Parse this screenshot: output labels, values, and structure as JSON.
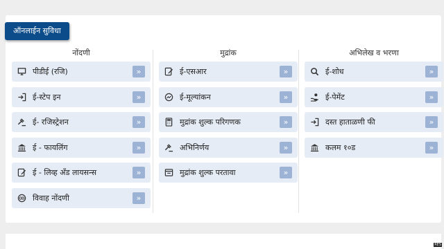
{
  "section_title": "ऑनलाईन सुविधा",
  "columns": [
    {
      "title": "नोंदणी",
      "items": [
        {
          "label": "पीडीई (रजि)",
          "icon": "monitor-icon"
        },
        {
          "label": "ई-स्टेप इन",
          "icon": "sign-in-icon"
        },
        {
          "label": "ई- रजिस्ट्रेशन",
          "icon": "gavel-icon"
        },
        {
          "label": "ई - फायलिंग",
          "icon": "bank-icon"
        },
        {
          "label": "ई - लिव्ह अँड लायसन्स",
          "icon": "edit-document-icon"
        },
        {
          "label": "विवाह नोंदणी",
          "icon": "rings-icon"
        }
      ]
    },
    {
      "title": "मुद्रांक",
      "items": [
        {
          "label": "ई-एसआर",
          "icon": "edit-document-icon"
        },
        {
          "label": "ई-मूल्यांकन",
          "icon": "trend-circle-icon"
        },
        {
          "label": "मुद्रांक शुल्क परिगणक",
          "icon": "calculator-icon"
        },
        {
          "label": "अभिनिर्णय",
          "icon": "gavel-icon"
        },
        {
          "label": "मुद्रांक शुल्क परतावा",
          "icon": "window-icon"
        }
      ]
    },
    {
      "title": "अभिलेख व भरणा",
      "items": [
        {
          "label": "ई-शोध",
          "icon": "search-icon"
        },
        {
          "label": "ई-पेमेंट",
          "icon": "hand-payment-icon"
        },
        {
          "label": "दस्त हाताळणी फी",
          "icon": "sign-in-icon"
        },
        {
          "label": "कलम १०ड",
          "icon": "bank-icon"
        }
      ]
    }
  ],
  "arrow_symbol": "»",
  "corner_badge": "RES",
  "colors": {
    "badge_bg": "#0d4c8b",
    "item_bg": "#e6ecf5",
    "arrow_bg": "#9db3d6",
    "page_bg": "#eeeeee"
  }
}
